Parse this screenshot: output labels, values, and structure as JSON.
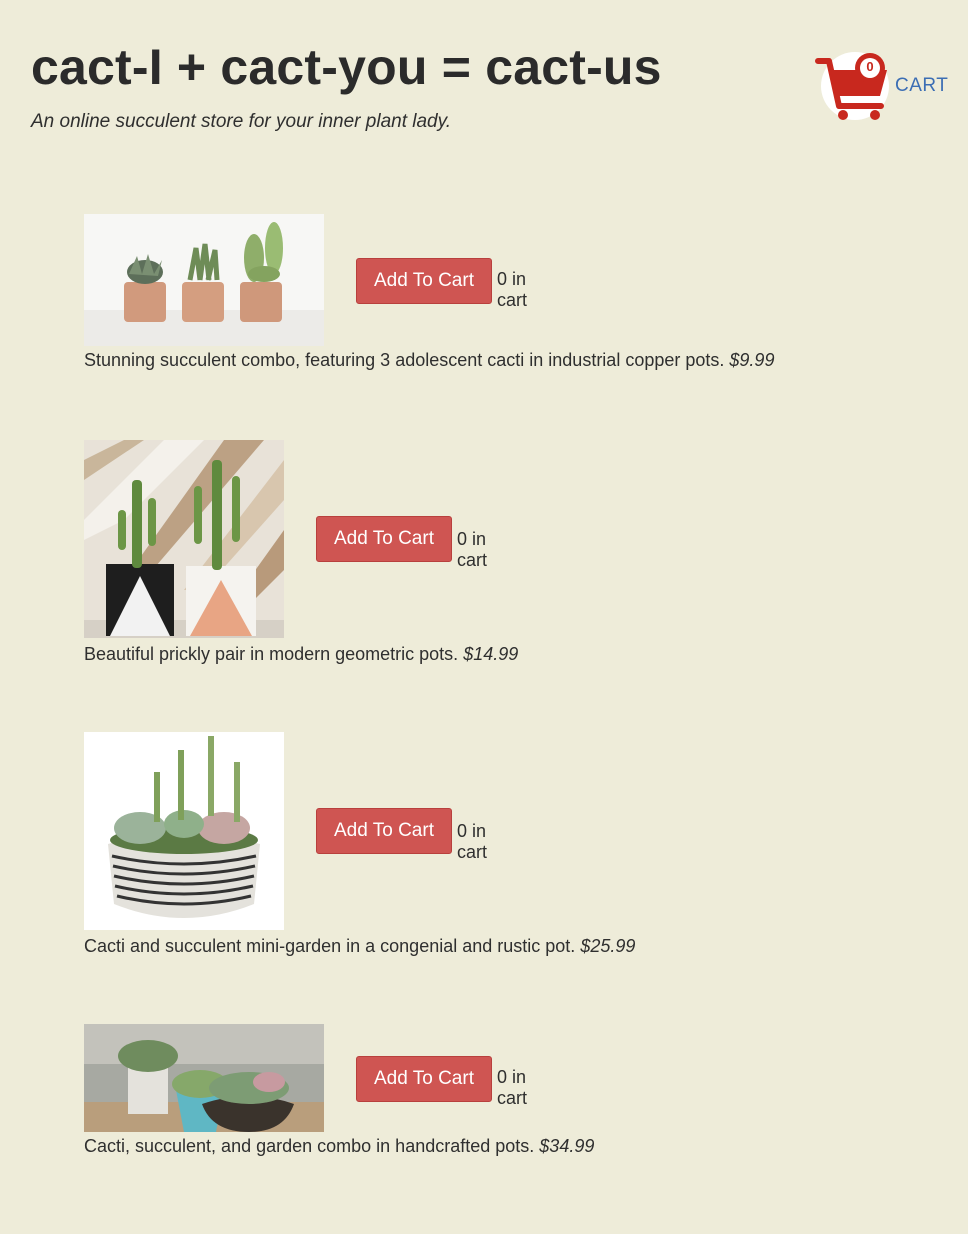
{
  "header": {
    "title": "cact-I + cact-you = cact-us",
    "tagline": "An online succulent store for your inner plant lady."
  },
  "cart": {
    "count": "0",
    "label": "CART",
    "icon": "shopping-cart-icon",
    "color": "#c8281e"
  },
  "products": [
    {
      "button_label": "Add To Cart",
      "in_cart": "0 in cart",
      "description": "Stunning succulent combo, featuring 3 adolescent cacti in industrial copper pots.",
      "price": "$9.99"
    },
    {
      "button_label": "Add To Cart",
      "in_cart": "0 in cart",
      "description": "Beautiful prickly pair in modern geometric pots.",
      "price": "$14.99"
    },
    {
      "button_label": "Add To Cart",
      "in_cart": "0 in cart",
      "description": "Cacti and succulent mini-garden in a congenial and rustic pot.",
      "price": "$25.99"
    },
    {
      "button_label": "Add To Cart",
      "in_cart": "0 in cart",
      "description": "Cacti, succulent, and garden combo in handcrafted pots.",
      "price": "$34.99"
    }
  ],
  "colors": {
    "background": "#eeecd9",
    "button": "#cf5552",
    "cart_link": "#3c6eb4"
  }
}
